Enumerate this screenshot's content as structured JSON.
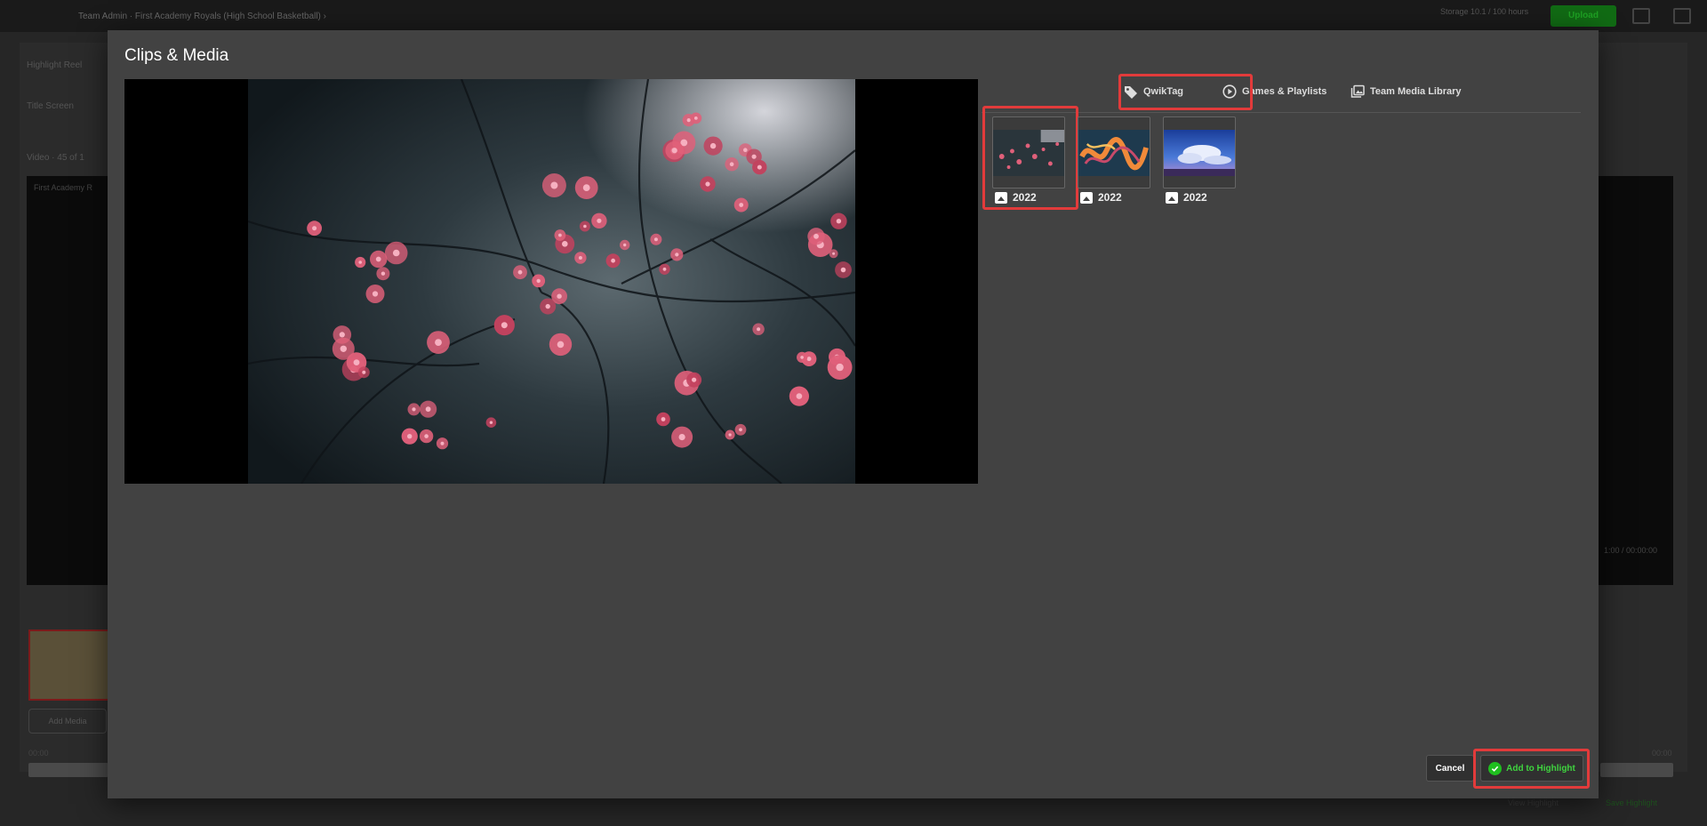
{
  "background": {
    "breadcrumb": "Team Admin · First Academy Royals (High School Basketball) ›",
    "usage": "Storage 10.1 / 100 hours",
    "upload_label": "Upload",
    "left_items": [
      "Highlight Reel",
      "Title Screen",
      "Video · 45 of 1"
    ],
    "video_caption": "First Academy R",
    "add_media_label": "Add Media",
    "time_left": "00:00",
    "time_right": "00:00",
    "right_timecode": "1:00 / 00:00:00",
    "bottom_left": "View Highlight",
    "bottom_right": "Save Highlight"
  },
  "modal": {
    "title": "Clips & Media",
    "tabs": [
      {
        "label": "QwikTag",
        "icon": "tag-icon"
      },
      {
        "label": "Games & Playlists",
        "icon": "play-circle-icon"
      },
      {
        "label": "Team Media Library",
        "icon": "photo-library-icon"
      }
    ],
    "active_tab": "Team Media Library",
    "media_items": [
      {
        "label": "2022",
        "type": "image",
        "theme": "pink-blossoms",
        "selected": true
      },
      {
        "label": "2022",
        "type": "image",
        "theme": "abstract-paint",
        "selected": false
      },
      {
        "label": "2022",
        "type": "image",
        "theme": "blue-sky",
        "selected": false
      }
    ],
    "cancel_label": "Cancel",
    "add_label": "Add to Highlight"
  },
  "colors": {
    "highlight_red": "#e23b3b",
    "add_green": "#3fd43f",
    "modal_bg": "#424242"
  }
}
